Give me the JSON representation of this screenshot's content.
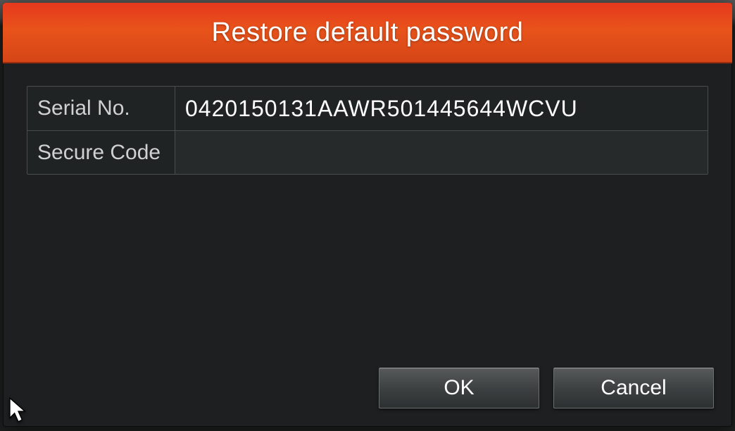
{
  "dialog": {
    "title": "Restore default password",
    "fields": {
      "serial_label": "Serial No.",
      "serial_value": "0420150131AAWR501445644WCVU",
      "secure_label": "Secure Code",
      "secure_value": ""
    },
    "buttons": {
      "ok": "OK",
      "cancel": "Cancel"
    }
  },
  "colors": {
    "accent": "#e8531b",
    "bg": "#1d1f20"
  }
}
